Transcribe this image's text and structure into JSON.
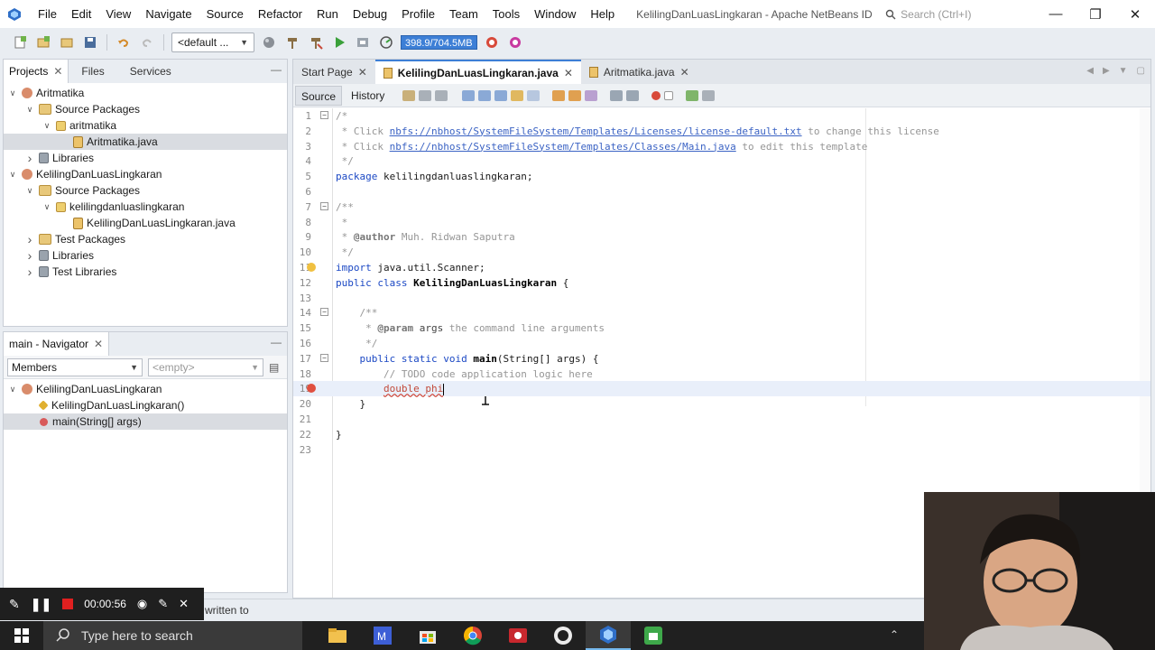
{
  "menubar": {
    "items": [
      "File",
      "Edit",
      "View",
      "Navigate",
      "Source",
      "Refactor",
      "Run",
      "Debug",
      "Profile",
      "Team",
      "Tools",
      "Window",
      "Help"
    ],
    "window_title": "KelilingDanLuasLingkaran - Apache NetBeans ID...",
    "search_placeholder": "Search (Ctrl+I)"
  },
  "toolbar": {
    "config": "<default ...",
    "memory": "398.9/704.5MB"
  },
  "projects_panel": {
    "tabs": [
      "Projects",
      "Files",
      "Services"
    ],
    "tree": [
      {
        "label": "Aritmatika",
        "level": 0,
        "icon": "project-icon",
        "expanded": true
      },
      {
        "label": "Source Packages",
        "level": 1,
        "icon": "source-packages-icon",
        "expanded": true
      },
      {
        "label": "aritmatika",
        "level": 2,
        "icon": "package-icon",
        "expanded": true
      },
      {
        "label": "Aritmatika.java",
        "level": 3,
        "icon": "java-file-icon",
        "selected": true
      },
      {
        "label": "Libraries",
        "level": 1,
        "icon": "libraries-icon",
        "expanded": false
      },
      {
        "label": "KelilingDanLuasLingkaran",
        "level": 0,
        "icon": "project-icon",
        "expanded": true
      },
      {
        "label": "Source Packages",
        "level": 1,
        "icon": "source-packages-icon",
        "expanded": true
      },
      {
        "label": "kelilingdanluaslingkaran",
        "level": 2,
        "icon": "package-icon",
        "expanded": true
      },
      {
        "label": "KelilingDanLuasLingkaran.java",
        "level": 3,
        "icon": "java-file-icon"
      },
      {
        "label": "Test Packages",
        "level": 1,
        "icon": "source-packages-icon",
        "expanded": false
      },
      {
        "label": "Libraries",
        "level": 1,
        "icon": "libraries-icon",
        "expanded": false
      },
      {
        "label": "Test Libraries",
        "level": 1,
        "icon": "libraries-icon",
        "expanded": false
      }
    ]
  },
  "navigator": {
    "title": "main - Navigator",
    "filter": "Members",
    "scope": "<empty>",
    "tree": [
      {
        "label": "KelilingDanLuasLingkaran",
        "level": 0
      },
      {
        "label": "KelilingDanLuasLingkaran()",
        "level": 1
      },
      {
        "label": "main(String[] args)",
        "level": 1,
        "selected": true
      }
    ]
  },
  "editor": {
    "tabs": [
      {
        "label": "Start Page",
        "active": false
      },
      {
        "label": "KelilingDanLuasLingkaran.java",
        "active": true
      },
      {
        "label": "Aritmatika.java",
        "active": false
      }
    ],
    "subtabs": [
      "Source",
      "History"
    ],
    "lines": [
      "/*",
      " * Click nbfs://nbhost/SystemFileSystem/Templates/Licenses/license-default.txt to change this license",
      " * Click nbfs://nbhost/SystemFileSystem/Templates/Classes/Main.java to edit this template",
      " */",
      "package kelilingdanluaslingkaran;",
      "",
      "/**",
      " *",
      " * @author Muh. Ridwan Saputra",
      " */",
      "import java.util.Scanner;",
      "public class KelilingDanLuasLingkaran {",
      "",
      "    /**",
      "     * @param args the command line arguments",
      "     */",
      "    public static void main(String[] args) {",
      "        // TODO code application logic here",
      "        double phi",
      "    }",
      "",
      "}",
      ""
    ]
  },
  "statusbar": {
    "text": "written to"
  },
  "recorder": {
    "time": "00:00:56"
  },
  "taskbar": {
    "search_placeholder": "Type here to search"
  }
}
